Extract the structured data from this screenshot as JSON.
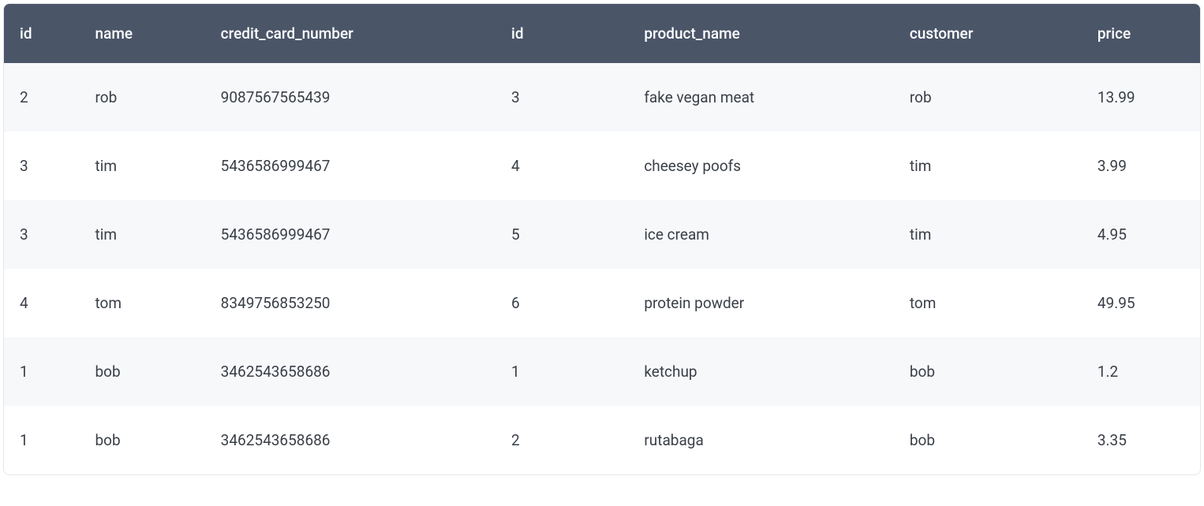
{
  "table": {
    "headers": [
      "id",
      "name",
      "credit_card_number",
      "id",
      "product_name",
      "customer",
      "price"
    ],
    "rows": [
      [
        "2",
        "rob",
        "9087567565439",
        "3",
        "fake vegan meat",
        "rob",
        "13.99"
      ],
      [
        "3",
        "tim",
        "5436586999467",
        "4",
        "cheesey poofs",
        "tim",
        "3.99"
      ],
      [
        "3",
        "tim",
        "5436586999467",
        "5",
        "ice cream",
        "tim",
        "4.95"
      ],
      [
        "4",
        "tom",
        "8349756853250",
        "6",
        "protein powder",
        "tom",
        "49.95"
      ],
      [
        "1",
        "bob",
        "3462543658686",
        "1",
        "ketchup",
        "bob",
        "1.2"
      ],
      [
        "1",
        "bob",
        "3462543658686",
        "2",
        "rutabaga",
        "bob",
        "3.35"
      ]
    ]
  }
}
